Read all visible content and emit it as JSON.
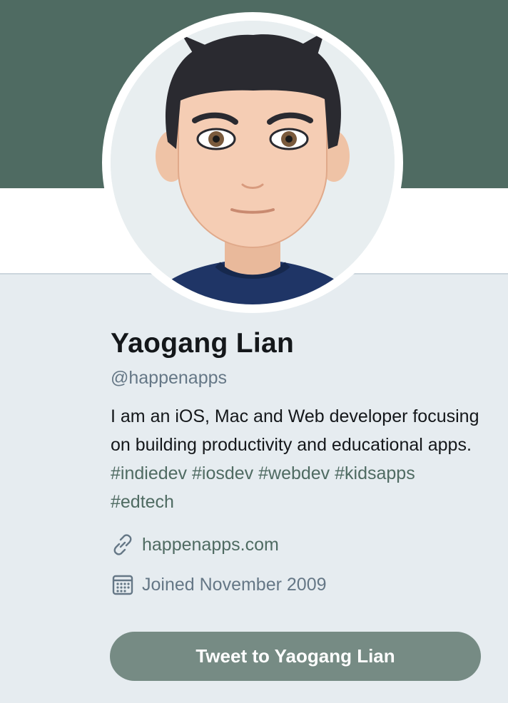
{
  "profile": {
    "name": "Yaogang Lian",
    "handle": "@happenapps",
    "bio_text": "I am an iOS, Mac and Web developer focusing on building productivity and educational apps.",
    "hashtags": [
      "#indiedev",
      "#iosdev",
      "#webdev",
      "#kidsapps",
      "#edtech"
    ],
    "website": "happenapps.com",
    "joined": "Joined November 2009"
  },
  "actions": {
    "tweet_button_label": "Tweet to Yaogang Lian"
  },
  "icons": {
    "link": "link-icon",
    "calendar": "calendar-icon"
  },
  "colors": {
    "banner": "#4f6b62",
    "accent": "#4f6b62",
    "button": "#768b84",
    "background": "#e6ecf0",
    "secondary_text": "#657786"
  }
}
